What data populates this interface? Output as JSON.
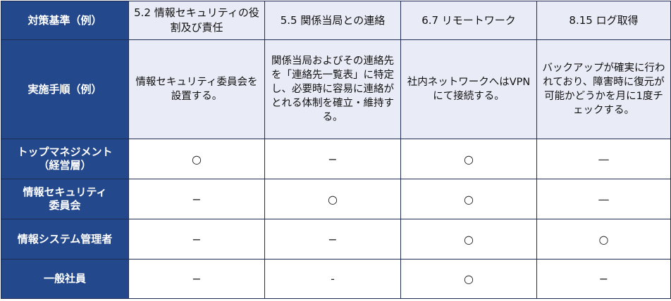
{
  "header_label": "対策基準（例）",
  "procedure_label": "実施手順（例）",
  "columns": [
    {
      "standard": "5.2 情報セキュリティの役割及び責任",
      "procedure": "情報セキュリティ委員会を設置する。"
    },
    {
      "standard": "5.5 関係当局との連絡",
      "procedure": "関係当局およびその連絡先を「連絡先一覧表」に特定し、必要時に容易に連絡がとれる体制を確立・維持する。"
    },
    {
      "standard": "6.7 リモートワーク",
      "procedure": "社内ネットワークへはVPNにて接続する。"
    },
    {
      "standard": "8.15 ログ取得",
      "procedure": "バックアップが確実に行われており、障害時に復元が可能かどうかを月に1度チェックする。"
    }
  ],
  "roles": [
    {
      "name": "トップマネジメント\n（経営層）",
      "marks": [
        "○",
        "−",
        "○",
        "—"
      ]
    },
    {
      "name": "情報セキュリティ\n委員会",
      "marks": [
        "−",
        "○",
        "○",
        "—"
      ]
    },
    {
      "name": "情報システム管理者",
      "marks": [
        "−",
        "−",
        "○",
        "○"
      ]
    },
    {
      "name": "一般社員",
      "marks": [
        "−",
        "-",
        "○",
        "−"
      ]
    }
  ]
}
